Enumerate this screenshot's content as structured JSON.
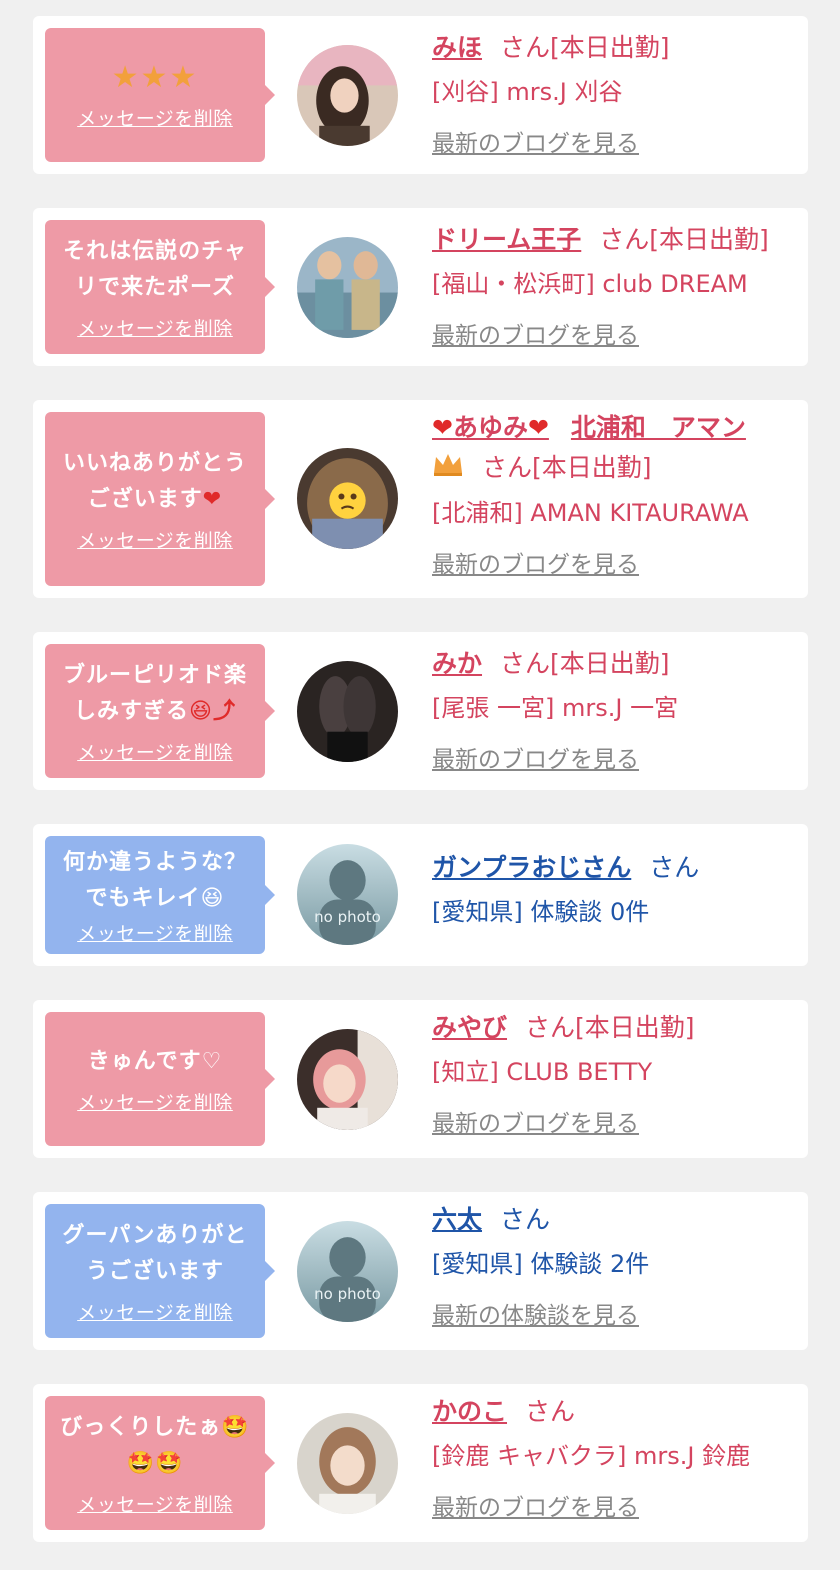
{
  "delete_label": "メッセージを削除",
  "cards": [
    {
      "message": "★★★",
      "name": "みほ",
      "suffix": "さん[本日出勤]",
      "shop": "[刈谷] mrs.J 刈谷",
      "link": "最新のブログを見る",
      "theme": "pink"
    },
    {
      "message": "それは伝説のチャリで来たポーズ",
      "name": "ドリーム王子",
      "suffix": "さん[本日出勤]",
      "shop": "[福山・松浜町]  club DREAM",
      "link": "最新のブログを見る",
      "theme": "pink"
    },
    {
      "message": "いいねありがとうございます",
      "heart_icon": "❤",
      "name_heart": "❤",
      "name": "あゆみ",
      "name_rest": "北浦和　アマン",
      "crown_icon": "crown-icon",
      "suffix": "さん[本日出勤]",
      "shop": "[北浦和] AMAN KITAURAWA",
      "link": "最新のブログを見る",
      "theme": "pink"
    },
    {
      "message": "ブルーピリオド楽しみすぎる",
      "emoji": "😆⤴",
      "name": "みか",
      "suffix": "さん[本日出勤]",
      "shop": "[尾張 一宮] mrs.J 一宮",
      "link": "最新のブログを見る",
      "theme": "pink"
    },
    {
      "message": "何か違うような？でもキレイ",
      "emoji": "😆",
      "name": "ガンプラおじさん",
      "suffix": "さん",
      "shop": "[愛知県] 体験談 0件",
      "theme": "blue",
      "nophoto": "no photo"
    },
    {
      "message": "きゅんです♡",
      "name": "みやび",
      "suffix": "さん[本日出勤]",
      "shop": "[知立] CLUB BETTY",
      "link": "最新のブログを見る",
      "theme": "pink"
    },
    {
      "message": "グーパンありがとうございます",
      "name": "六太",
      "suffix": "さん",
      "shop": "[愛知県] 体験談 2件",
      "link": "最新の体験談を見る",
      "theme": "blue",
      "nophoto": "no photo"
    },
    {
      "message": "びっくりしたぁ🤩🤩🤩",
      "name": "かのこ",
      "suffix": "さん",
      "shop": "[鈴鹿 キャバクラ] mrs.J 鈴鹿",
      "link": "最新のブログを見る",
      "theme": "pink"
    }
  ],
  "colors": {
    "background": "#f0f0f0",
    "pink_bubble": "#ee9aa6",
    "blue_bubble": "#93b4ee",
    "pink_text": "#d4445f",
    "blue_text": "#1f55a8",
    "link_gray": "#888888"
  }
}
